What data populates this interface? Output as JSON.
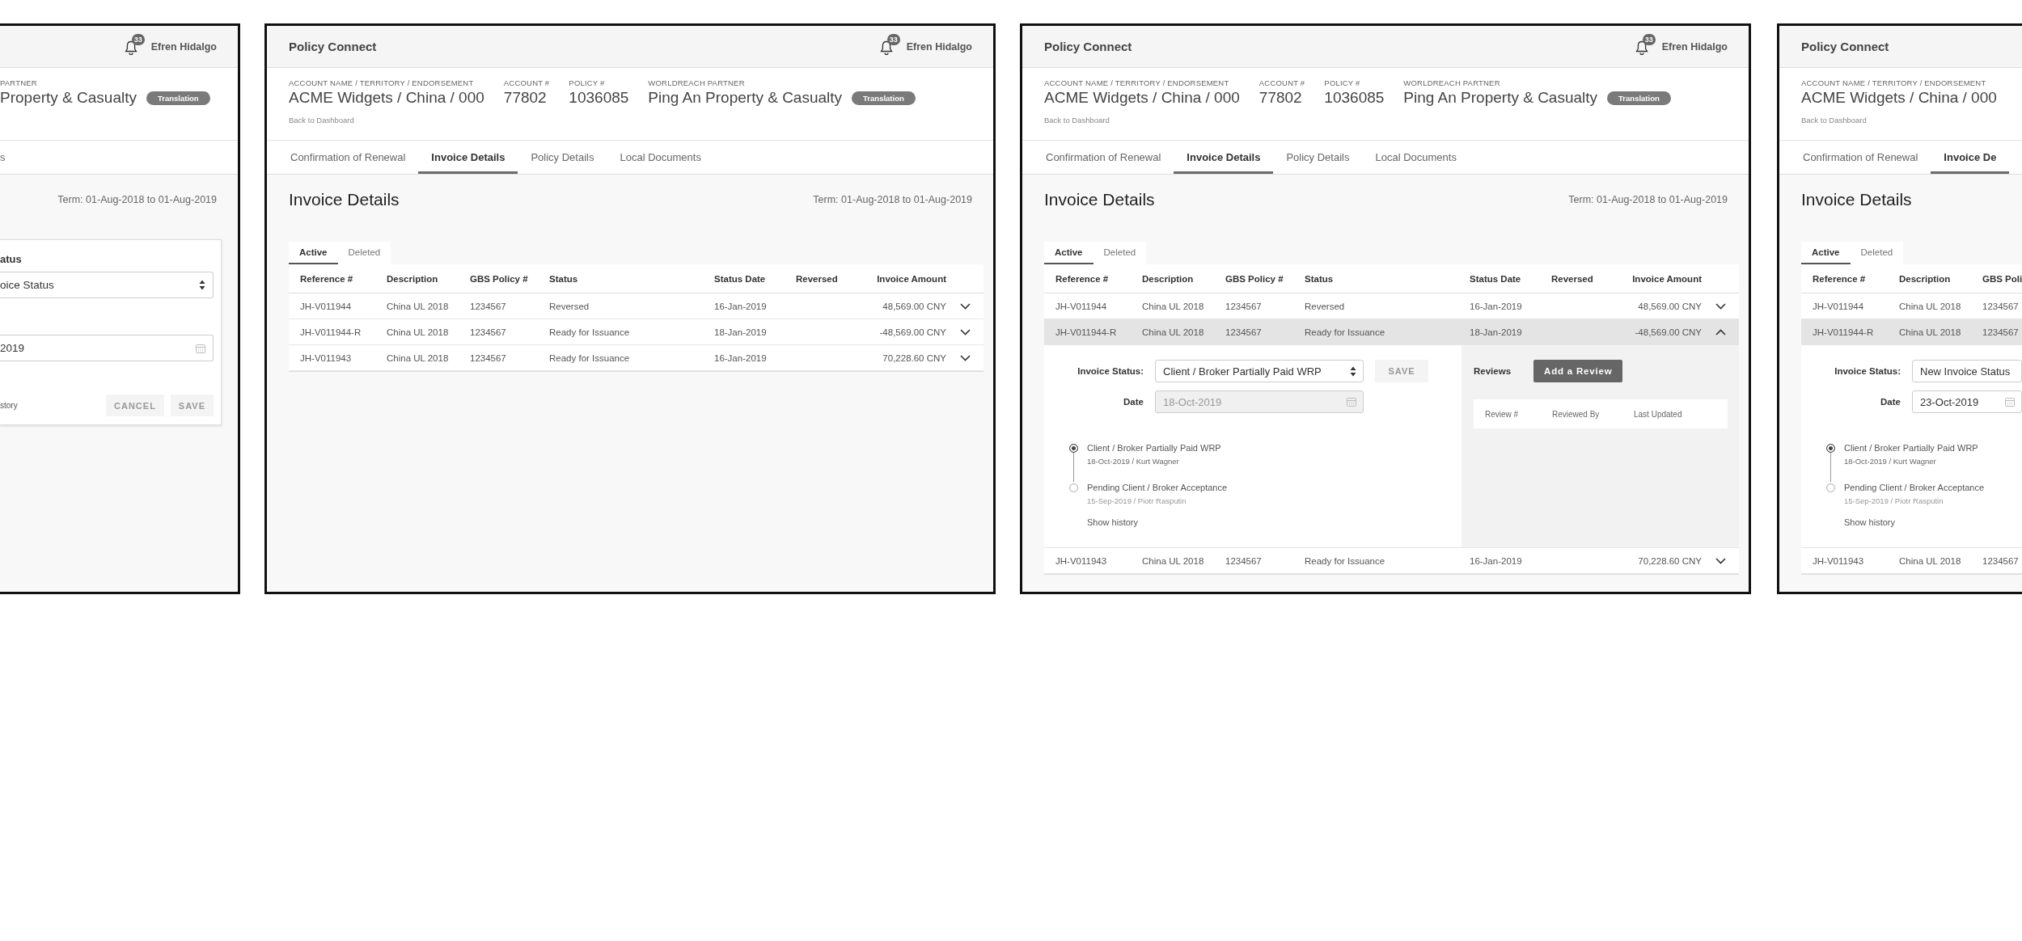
{
  "screens": [
    {
      "kind": "left-fragment",
      "user": {
        "name": "Efren Hidalgo",
        "notifications": "33"
      },
      "fields": [
        {
          "label": "PARTNER",
          "value": "Property & Casualty"
        }
      ],
      "badge": "Translation",
      "tabs": [
        {
          "label": "s",
          "selected": false
        }
      ],
      "term": "Term: 01-Aug-2018 to 01-Aug-2019",
      "popup": {
        "label": "atus",
        "select": "oice Status",
        "date": "2019",
        "link": "story",
        "buttons": [
          {
            "label": "CANCEL",
            "disabled": true
          },
          {
            "label": "SAVE",
            "disabled": true
          }
        ]
      }
    },
    {
      "kind": "full",
      "app_title": "Policy Connect",
      "user": {
        "name": "Efren Hidalgo",
        "notifications": "33"
      },
      "fields": [
        {
          "label": "ACCOUNT NAME / TERRITORY / ENDORSEMENT",
          "value": "ACME Widgets / China / 000"
        },
        {
          "label": "ACCOUNT #",
          "value": "77802"
        },
        {
          "label": "POLICY #",
          "value": "1036085"
        },
        {
          "label": "WORLDREACH PARTNER",
          "value": "Ping An Property & Casualty"
        }
      ],
      "badge": "Translation",
      "back_link": "Back to Dashboard",
      "tabs": [
        {
          "label": "Confirmation of Renewal",
          "selected": false
        },
        {
          "label": "Invoice Details",
          "selected": true
        },
        {
          "label": "Policy Details",
          "selected": false
        },
        {
          "label": "Local Documents",
          "selected": false
        }
      ],
      "heading": "Invoice Details",
      "term": "Term: 01-Aug-2018 to 01-Aug-2019",
      "subtabs": [
        {
          "label": "Active",
          "selected": true
        },
        {
          "label": "Deleted",
          "selected": false
        }
      ],
      "table": {
        "columns": [
          "Reference #",
          "Description",
          "GBS Policy #",
          "Status",
          "Status Date",
          "Reversed",
          "Invoice Amount"
        ],
        "rows": [
          {
            "cells": [
              "JH-V011944",
              "China UL 2018",
              "1234567",
              "Reversed",
              "16-Jan-2019",
              null,
              "48,569.00 CNY"
            ],
            "expanded": false
          },
          {
            "cells": [
              "JH-V011944-R",
              "China UL 2018",
              "1234567",
              "Ready for Issuance",
              "18-Jan-2019",
              null,
              "-48,569.00 CNY"
            ],
            "expanded": false
          },
          {
            "cells": [
              "JH-V011943",
              "China UL 2018",
              "1234567",
              "Ready for Issuance",
              "16-Jan-2019",
              null,
              "70,228.60 CNY"
            ],
            "expanded": false
          }
        ]
      }
    },
    {
      "kind": "full",
      "app_title": "Policy Connect",
      "user": {
        "name": "Efren Hidalgo",
        "notifications": "33"
      },
      "fields": [
        {
          "label": "ACCOUNT NAME / TERRITORY / ENDORSEMENT",
          "value": "ACME Widgets / China / 000"
        },
        {
          "label": "ACCOUNT #",
          "value": "77802"
        },
        {
          "label": "POLICY #",
          "value": "1036085"
        },
        {
          "label": "WORLDREACH PARTNER",
          "value": "Ping An Property & Casualty"
        }
      ],
      "badge": "Translation",
      "back_link": "Back to Dashboard",
      "tabs": [
        {
          "label": "Confirmation of Renewal",
          "selected": false
        },
        {
          "label": "Invoice Details",
          "selected": true
        },
        {
          "label": "Policy Details",
          "selected": false
        },
        {
          "label": "Local Documents",
          "selected": false
        }
      ],
      "heading": "Invoice Details",
      "term": "Term: 01-Aug-2018 to 01-Aug-2019",
      "subtabs": [
        {
          "label": "Active",
          "selected": true
        },
        {
          "label": "Deleted",
          "selected": false
        }
      ],
      "table": {
        "columns": [
          "Reference #",
          "Description",
          "GBS Policy #",
          "Status",
          "Status Date",
          "Reversed",
          "Invoice Amount"
        ],
        "rows": [
          {
            "cells": [
              "JH-V011944",
              "China UL 2018",
              "1234567",
              "Reversed",
              "16-Jan-2019",
              null,
              "48,569.00 CNY"
            ],
            "expanded": false
          },
          {
            "cells": [
              "JH-V011944-R",
              "China UL 2018",
              "1234567",
              "Ready for Issuance",
              "18-Jan-2019",
              null,
              "-48,569.00 CNY"
            ],
            "expanded": true,
            "detail": {
              "status": {
                "label": "Invoice Status:",
                "value": "Client / Broker Partially Paid WRP"
              },
              "save": {
                "label": "SAVE",
                "disabled": true
              },
              "date": {
                "label": "Date",
                "value": "18-Oct-2019",
                "disabled": true
              },
              "history": [
                {
                  "title": "Client / Broker Partially Paid WRP",
                  "meta": "18-Oct-2019 / Kurt Wagner",
                  "current": true
                },
                {
                  "title": "Pending Client / Broker Acceptance",
                  "meta": "15-Sep-2019 / Piotr Rasputin",
                  "current": false
                }
              ],
              "show_history": "Show history",
              "reviews": {
                "title": "Reviews",
                "button": "Add a Review",
                "columns": [
                  "Review #",
                  "Reviewed By",
                  "Last Updated"
                ]
              }
            }
          },
          {
            "cells": [
              "JH-V011943",
              "China UL 2018",
              "1234567",
              "Ready for Issuance",
              "16-Jan-2019",
              null,
              "70,228.60 CNY"
            ],
            "expanded": false
          }
        ]
      }
    },
    {
      "kind": "right-fragment",
      "app_title": "Policy Connect",
      "fields": [
        {
          "label": "ACCOUNT NAME / TERRITORY / ENDORSEMENT",
          "value": "ACME Widgets / China / 000"
        }
      ],
      "back_link": "Back to Dashboard",
      "tabs": [
        {
          "label": "Confirmation of Renewal",
          "selected": false
        },
        {
          "label": "Invoice De",
          "selected": true
        }
      ],
      "heading": "Invoice Details",
      "subtabs": [
        {
          "label": "Active",
          "selected": true
        },
        {
          "label": "Deleted",
          "selected": false
        }
      ],
      "table": {
        "columns": [
          "Reference #",
          "Description",
          "GBS Poli"
        ],
        "rows": [
          {
            "cells": [
              "JH-V011944",
              "China UL 2018",
              "1234567"
            ],
            "expanded": false
          },
          {
            "cells": [
              "JH-V011944-R",
              "China UL 2018",
              "1234567"
            ],
            "expanded": true,
            "detail": {
              "status": {
                "label": "Invoice Status:",
                "value": "New Invoice Status"
              },
              "date": {
                "label": "Date",
                "value": "23-Oct-2019",
                "disabled": false
              },
              "history": [
                {
                  "title": "Client / Broker Partially Paid WRP",
                  "meta": "18-Oct-2019 / Kurt Wagner",
                  "current": true
                },
                {
                  "title": "Pending Client / Broker Acceptance",
                  "meta": "15-Sep-2019 / Piotr Rasputin",
                  "current": false
                }
              ],
              "show_history": "Show history"
            }
          },
          {
            "cells": [
              "JH-V011943",
              "China UL 2018",
              "1234567"
            ],
            "expanded": false
          }
        ]
      }
    }
  ]
}
